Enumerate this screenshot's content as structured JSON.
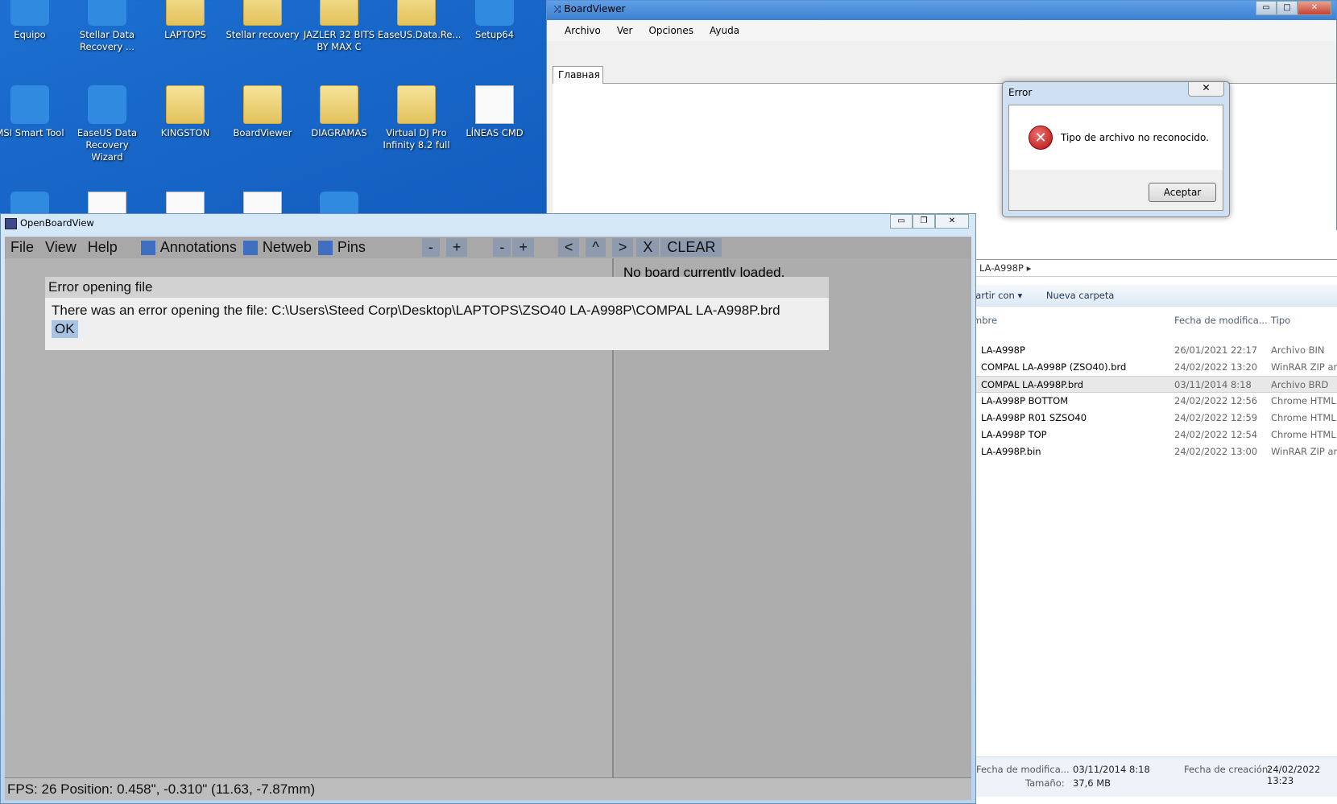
{
  "desktop": {
    "icons": [
      {
        "label": "Equipo",
        "kind": "computer"
      },
      {
        "label": "Stellar Data Recovery ...",
        "kind": "app"
      },
      {
        "label": "LAPTOPS",
        "kind": "folder"
      },
      {
        "label": "Stellar recovery",
        "kind": "folder"
      },
      {
        "label": "JAZLER 32 BITS BY MAX C",
        "kind": "folder"
      },
      {
        "label": "EaseUS.Data.Re...",
        "kind": "folder"
      },
      {
        "label": "Setup64",
        "kind": "app"
      },
      {
        "label": "MSI Smart Tool",
        "kind": "app"
      },
      {
        "label": "EaseUS Data Recovery Wizard",
        "kind": "app"
      },
      {
        "label": "KINGSTON",
        "kind": "folder"
      },
      {
        "label": "BoardViewer",
        "kind": "folder"
      },
      {
        "label": "DIAGRAMAS",
        "kind": "folder"
      },
      {
        "label": "Virtual DJ Pro Infinity 8.2 full",
        "kind": "folder"
      },
      {
        "label": "LÍNEAS CMD",
        "kind": "doc"
      }
    ]
  },
  "boardviewer": {
    "title": "BoardViewer",
    "menu": [
      "Archivo",
      "Ver",
      "Opciones",
      "Ayuda"
    ],
    "tab": "Главная"
  },
  "error_dialog": {
    "title": "Error",
    "message": "Tipo de archivo no reconocido.",
    "button": "Aceptar",
    "close": "✕"
  },
  "explorer": {
    "breadcrumb": "LA-A998P",
    "toolbar": {
      "share": "partir con ▾",
      "new_folder": "Nueva carpeta"
    },
    "columns": [
      "mbre",
      "Fecha de modifica...",
      "Tipo"
    ],
    "rows": [
      {
        "name": "LA-A998P",
        "date": "26/01/2021 22:17",
        "type": "Archivo BIN"
      },
      {
        "name": "COMPAL LA-A998P (ZSO40).brd",
        "date": "24/02/2022 13:20",
        "type": "WinRAR ZIP arc"
      },
      {
        "name": "COMPAL LA-A998P.brd",
        "date": "03/11/2014 8:18",
        "type": "Archivo BRD",
        "selected": true
      },
      {
        "name": "LA-A998P BOTTOM",
        "date": "24/02/2022 12:56",
        "type": "Chrome HTML"
      },
      {
        "name": "LA-A998P R01 SZSO40",
        "date": "24/02/2022 12:59",
        "type": "Chrome HTML"
      },
      {
        "name": "LA-A998P TOP",
        "date": "24/02/2022 12:54",
        "type": "Chrome HTML"
      },
      {
        "name": "LA-A998P.bin",
        "date": "24/02/2022 13:00",
        "type": "WinRAR ZIP arc"
      }
    ],
    "details": {
      "modified_label": "Fecha de modifica...",
      "modified": "03/11/2014 8:18",
      "created_label": "Fecha de creación:",
      "created": "24/02/2022 13:23",
      "size_label": "Tamaño:",
      "size": "37,6 MB"
    }
  },
  "obv": {
    "title": "OpenBoardView",
    "menu": [
      "File",
      "View",
      "Help"
    ],
    "toggles": [
      "Annotations",
      "Netweb",
      "Pins"
    ],
    "buttons": [
      "-",
      "+",
      "-",
      "+",
      "<",
      "^",
      ">",
      "X",
      "CLEAR"
    ],
    "side_text": "No board currently loaded.",
    "modal": {
      "title": "Error opening file",
      "message": "There was an error opening the file: C:\\Users\\Steed Corp\\Desktop\\LAPTOPS\\ZSO40 LA-A998P\\COMPAL LA-A998P.brd",
      "ok": "OK"
    },
    "status": "FPS: 26  Position: 0.458\", -0.310\" (11.63, -7.87mm)"
  }
}
